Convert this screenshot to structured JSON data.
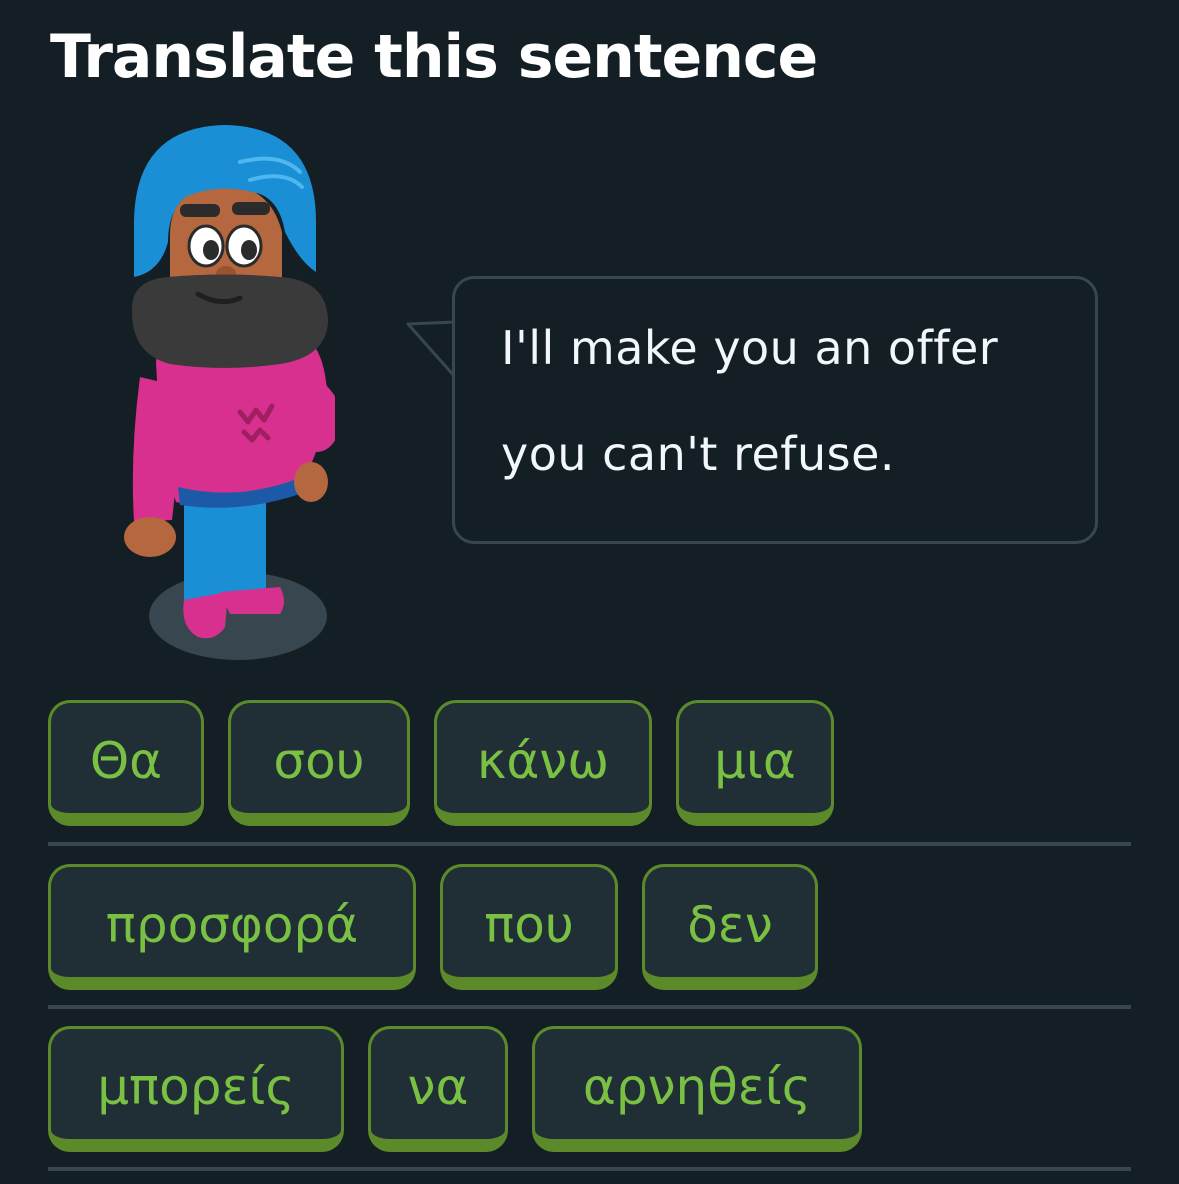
{
  "header": {
    "title": "Translate this sentence"
  },
  "prompt": {
    "line1": "I'll make you an offer",
    "line2": "you can't refuse."
  },
  "word_bank": {
    "rows": [
      [
        "Θα",
        "σου",
        "κάνω",
        "μια"
      ],
      [
        "προσφορά",
        "που",
        "δεν"
      ],
      [
        "μπορείς",
        "να",
        "αρνηθείς"
      ]
    ]
  },
  "colors": {
    "background": "#131f24",
    "tile_text": "#79c043",
    "tile_border": "#5c8a2a",
    "tile_fill": "#202f36",
    "bubble_border": "#37464f"
  },
  "icons": {
    "character": "character-illustration",
    "bubble_tail": "speech-bubble-tail"
  }
}
